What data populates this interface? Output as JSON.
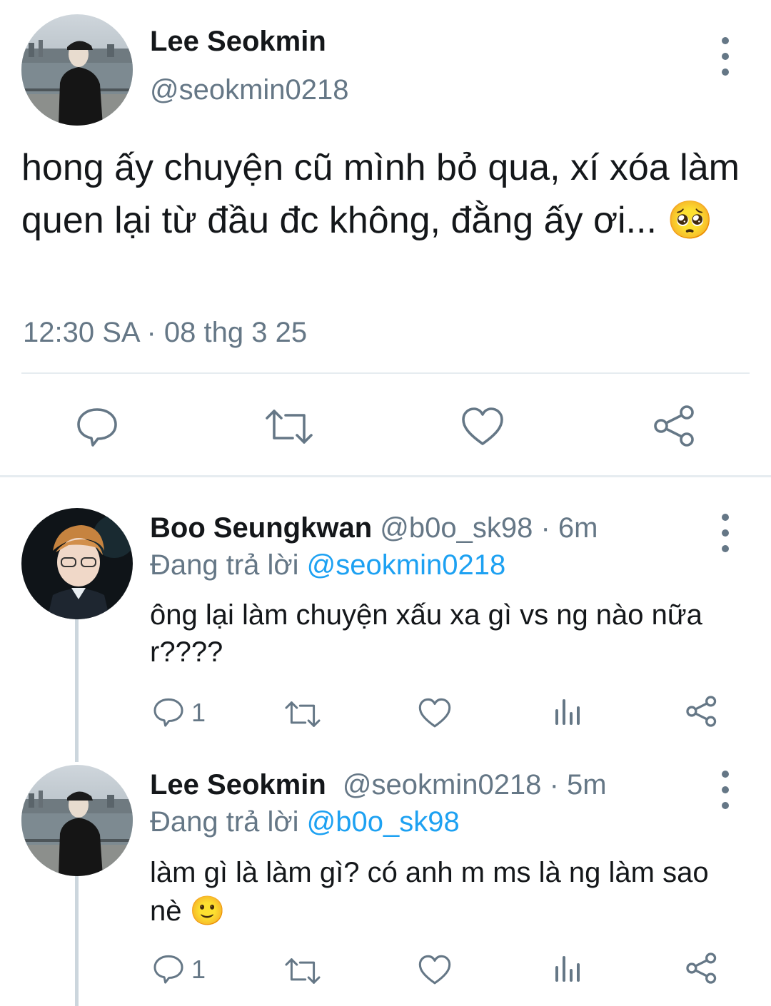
{
  "main_tweet": {
    "name": "Lee Seokmin",
    "handle": "@seokmin0218",
    "text": "hong ấy chuyện cũ mình bỏ qua, xí xóa làm quen lại từ đầu đc không, đằng ấy ơi...",
    "emoji": "🥺",
    "timestamp": "12:30 SA · 08 thg 3 25"
  },
  "replies": [
    {
      "name": "Boo Seungkwan",
      "handle": "@b0o_sk98",
      "time": "· 6m",
      "replying_label": "Đang trả lời",
      "replying_to": "@seokmin0218",
      "text": "ông lại làm chuyện xấu xa gì vs ng nào nữa r????",
      "reply_count": "1"
    },
    {
      "name": "Lee Seokmin",
      "handle": "@seokmin0218",
      "time": "· 5m",
      "replying_label": "Đang trả lời",
      "replying_to": "@b0o_sk98",
      "text": "làm gì là làm gì? có anh m ms là ng làm sao nè",
      "emoji": "🙂",
      "reply_count": "1"
    }
  ],
  "icons": [
    "reply-icon",
    "retweet-icon",
    "like-icon",
    "share-icon",
    "analytics-icon",
    "more-icon"
  ],
  "colors": {
    "accent": "#1da1f2",
    "muted": "#657786",
    "border": "#e6ecf0"
  }
}
